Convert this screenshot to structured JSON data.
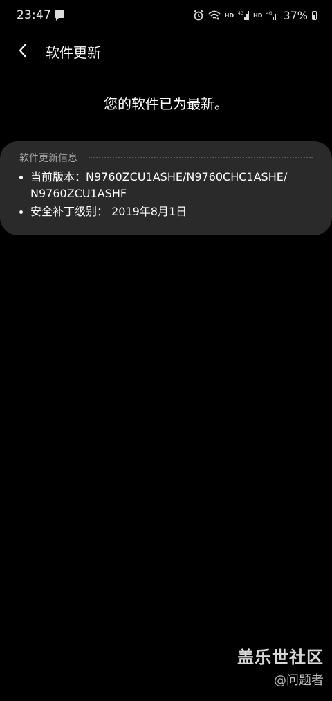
{
  "status_bar": {
    "time": "23:47",
    "hd_label_1": "HD",
    "hd_label_2": "HD",
    "battery": "37%"
  },
  "header": {
    "title": "软件更新"
  },
  "main": {
    "status_message": "您的软件已为最新。"
  },
  "info_card": {
    "heading": "软件更新信息",
    "items": [
      {
        "text": "当前版本：N9760ZCU1ASHE/N9760CHC1ASHE/ N9760ZCU1ASHF"
      },
      {
        "text": "安全补丁级别： 2019年8月1日"
      }
    ]
  },
  "watermark": {
    "title": "盖乐世社区",
    "user": "@问题者"
  },
  "colors": {
    "background": "#000000",
    "card": "#2a2a2a",
    "text": "#ffffff",
    "muted": "#a8a8a8"
  },
  "icons": {
    "back": "chevron-left-icon",
    "chat": "chat-bubble-icon",
    "alarm": "alarm-icon",
    "wifi": "wifi-icon",
    "signal": "signal-icon",
    "battery": "battery-icon"
  }
}
